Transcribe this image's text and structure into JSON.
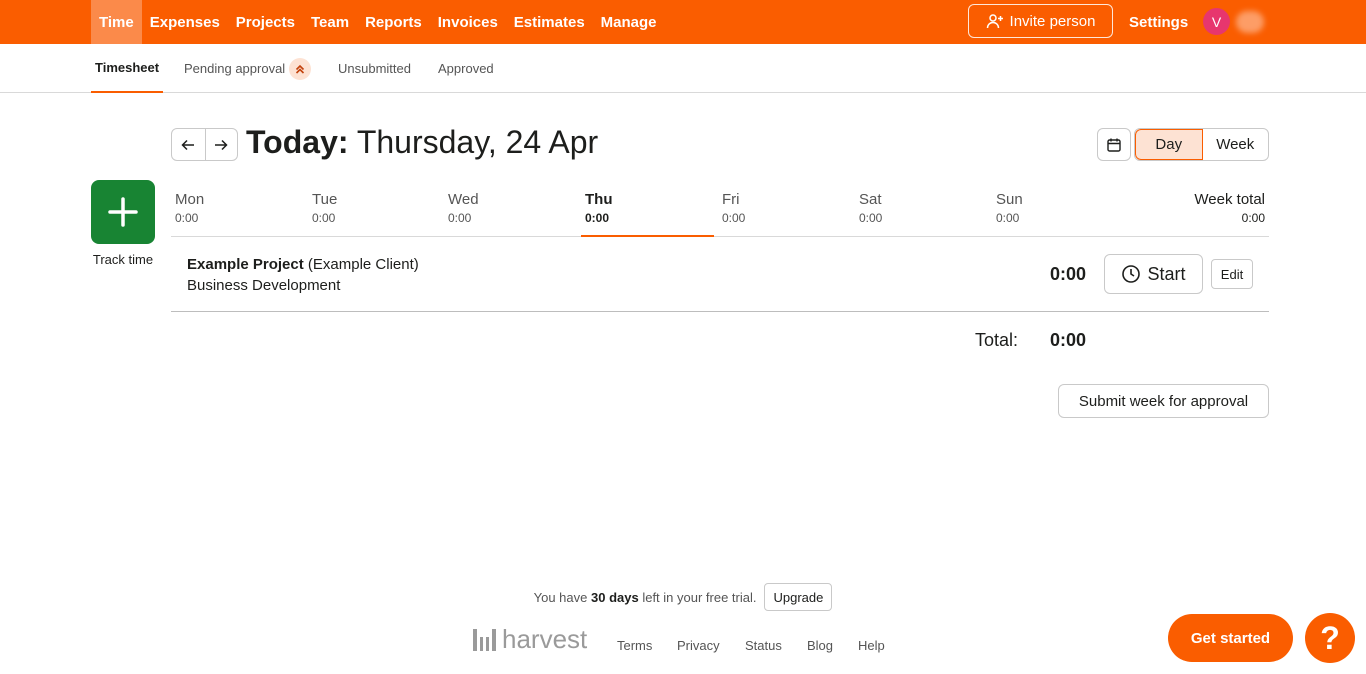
{
  "topnav": {
    "items": [
      {
        "label": "Time",
        "active": true
      },
      {
        "label": "Expenses"
      },
      {
        "label": "Projects"
      },
      {
        "label": "Team"
      },
      {
        "label": "Reports"
      },
      {
        "label": "Invoices"
      },
      {
        "label": "Estimates"
      },
      {
        "label": "Manage"
      }
    ],
    "invite_label": "Invite person",
    "settings_label": "Settings",
    "avatar_initial": "V",
    "brand_color": "#fa5d00"
  },
  "subnav": {
    "tabs": [
      {
        "label": "Timesheet",
        "active": true
      },
      {
        "label": "Pending approval"
      },
      {
        "label": "Unsubmitted"
      },
      {
        "label": "Approved"
      }
    ]
  },
  "header": {
    "date_prefix": "Today:",
    "date_text": "Thursday, 24 Apr",
    "views": [
      {
        "label": "Day",
        "active": true
      },
      {
        "label": "Week"
      }
    ]
  },
  "track": {
    "label": "Track time",
    "button_color": "#188433"
  },
  "week": {
    "days": [
      {
        "name": "Mon",
        "time": "0:00"
      },
      {
        "name": "Tue",
        "time": "0:00"
      },
      {
        "name": "Wed",
        "time": "0:00"
      },
      {
        "name": "Thu",
        "time": "0:00",
        "active": true
      },
      {
        "name": "Fri",
        "time": "0:00"
      },
      {
        "name": "Sat",
        "time": "0:00"
      },
      {
        "name": "Sun",
        "time": "0:00"
      }
    ],
    "total_label": "Week total",
    "total_time": "0:00"
  },
  "entry": {
    "project": "Example Project",
    "client": "(Example Client)",
    "task": "Business Development",
    "duration": "0:00",
    "start_label": "Start",
    "edit_label": "Edit"
  },
  "totals": {
    "label": "Total:",
    "value": "0:00"
  },
  "submit_label": "Submit week for approval",
  "footer": {
    "trial_prefix": "You have",
    "trial_days": "30 days",
    "trial_suffix": "left in your free trial.",
    "upgrade_label": "Upgrade",
    "logo_text": "harvest",
    "links": [
      "Terms",
      "Privacy",
      "Status",
      "Blog",
      "Help"
    ]
  },
  "get_started_label": "Get started",
  "help_label": "?"
}
